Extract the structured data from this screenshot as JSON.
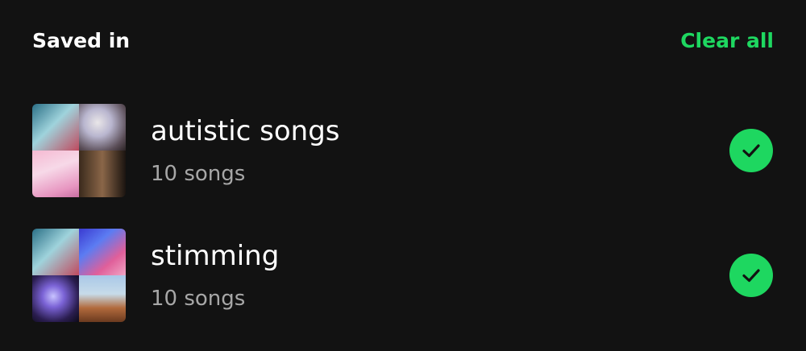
{
  "header": {
    "title": "Saved in",
    "clear_all_label": "Clear all"
  },
  "playlists": [
    {
      "title": "autistic songs",
      "subtitle": "10 songs",
      "selected_icon": "checkmark-icon"
    },
    {
      "title": "stimming",
      "subtitle": "10 songs",
      "selected_icon": "checkmark-icon"
    }
  ],
  "colors": {
    "background": "#121212",
    "accent": "#1ed760",
    "text_primary": "#ffffff",
    "text_secondary": "#a7a7a7"
  }
}
